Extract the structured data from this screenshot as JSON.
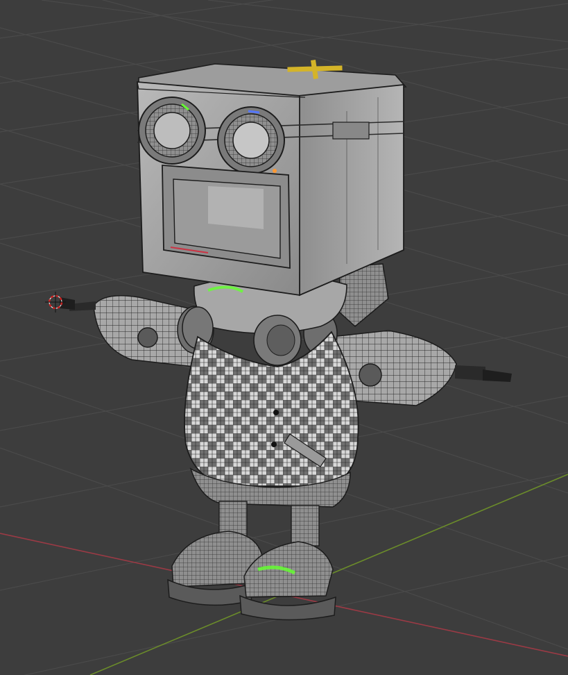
{
  "viewport": {
    "mode": "edit-mesh",
    "shading": "textured-checker",
    "overlay": "wireframe"
  },
  "colors": {
    "background": "#3d3d3d",
    "grid_line": "#4a4a4a",
    "x_axis": "#9b3a45",
    "y_axis": "#6b8c2a",
    "mesh_light": "#c9c9c9",
    "mesh_mid": "#9a9a9a",
    "mesh_dark": "#555555",
    "wire": "#1c1c1c",
    "selected_face": "#66ff33",
    "marker": "#d4b428",
    "cursor_red": "#cc2222"
  },
  "icons": {
    "cursor": "3d-cursor-icon",
    "top_marker": "plus-marker-icon"
  }
}
